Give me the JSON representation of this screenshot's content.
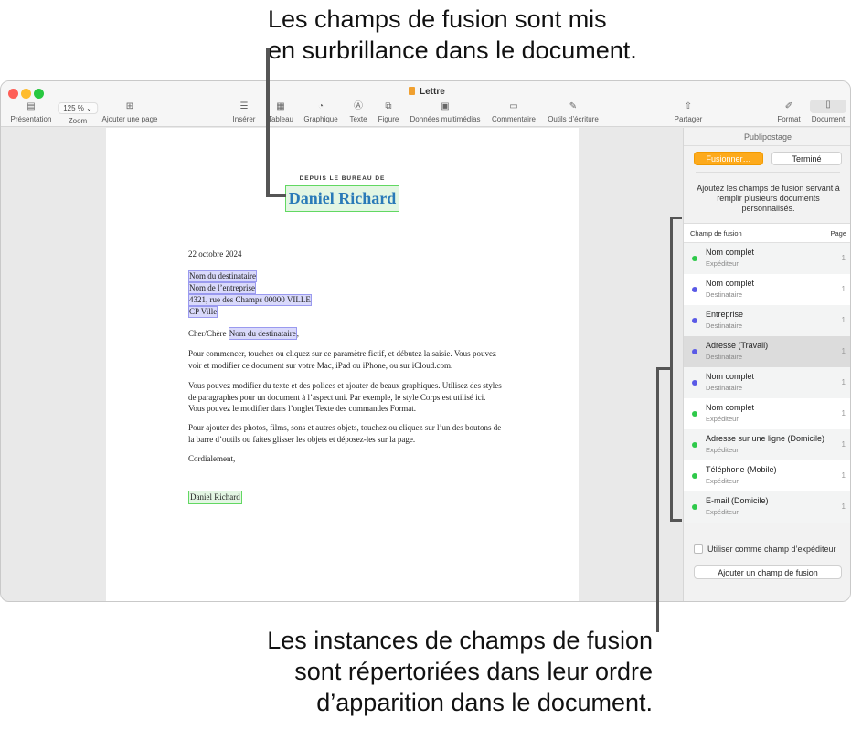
{
  "callouts": {
    "top": [
      "Les champs de fusion sont mis",
      "en surbrillance dans le document."
    ],
    "bottom": [
      "Les instances de champs de fusion",
      "sont répertoriées dans leur ordre",
      "d’apparition dans le document."
    ]
  },
  "window": {
    "title": "Lettre"
  },
  "toolbar": {
    "presentation": "Présentation",
    "zoom_value": "125 %",
    "zoom": "Zoom",
    "add_page": "Ajouter une page",
    "insert": "Insérer",
    "table": "Tableau",
    "chart": "Graphique",
    "text": "Texte",
    "shape": "Figure",
    "media": "Données multimédias",
    "comment": "Commentaire",
    "writing_tools": "Outils d’écriture",
    "share": "Partager",
    "format": "Format",
    "document": "Document"
  },
  "document": {
    "header_small": "DEPUIS LE BUREAU DE",
    "header_name": "Daniel Richard",
    "date": "22 octobre 2024",
    "address": [
      "Nom du destinataire",
      "Nom de l’entreprise",
      "4321, rue des Champs 00000 VILLE",
      "CP Ville"
    ],
    "greeting_prefix": "Cher/Chère ",
    "greeting_field": "Nom du destinataire",
    "greeting_suffix": ",",
    "paragraphs": [
      "Pour commencer, touchez ou cliquez sur ce paramètre fictif, et débutez la saisie. Vous pouvez voir et modifier ce document sur votre Mac, iPad ou iPhone, ou sur iCloud.com.",
      "Vous pouvez modifier du texte et des polices et ajouter de beaux graphiques. Utilisez des styles de paragraphes pour un document à l’aspect uni. Par exemple, le style Corps est utilisé ici. Vous pouvez le modifier dans l’onglet Texte des commandes Format.",
      "Pour ajouter des photos, films, sons et autres objets, touchez ou cliquez sur l’un des boutons de la barre d’outils ou faites glisser les objets et déposez-les sur la page."
    ],
    "closing": "Cordialement,",
    "signature": "Daniel Richard"
  },
  "sidebar": {
    "title": "Publipostage",
    "merge_button": "Fusionner…",
    "done_button": "Terminé",
    "description": "Ajoutez les champs de fusion servant à remplir plusieurs documents personnalisés.",
    "col_field": "Champ de fusion",
    "col_page": "Page",
    "rows": [
      {
        "name": "Nom complet",
        "type": "Expéditeur",
        "page": "1",
        "color": "#2ec94a"
      },
      {
        "name": "Nom complet",
        "type": "Destinataire",
        "page": "1",
        "color": "#5a5ae6"
      },
      {
        "name": "Entreprise",
        "type": "Destinataire",
        "page": "1",
        "color": "#5a5ae6"
      },
      {
        "name": "Adresse (Travail)",
        "type": "Destinataire",
        "page": "1",
        "color": "#5a5ae6"
      },
      {
        "name": "Nom complet",
        "type": "Destinataire",
        "page": "1",
        "color": "#5a5ae6"
      },
      {
        "name": "Nom complet",
        "type": "Expéditeur",
        "page": "1",
        "color": "#2ec94a"
      },
      {
        "name": "Adresse sur une ligne (Domicile)",
        "type": "Expéditeur",
        "page": "1",
        "color": "#2ec94a"
      },
      {
        "name": "Téléphone (Mobile)",
        "type": "Expéditeur",
        "page": "1",
        "color": "#2ec94a"
      },
      {
        "name": "E-mail (Domicile)",
        "type": "Expéditeur",
        "page": "1",
        "color": "#2ec94a"
      }
    ],
    "sender_checkbox": "Utiliser comme champ d’expéditeur",
    "add_field_button": "Ajouter un champ de fusion"
  }
}
